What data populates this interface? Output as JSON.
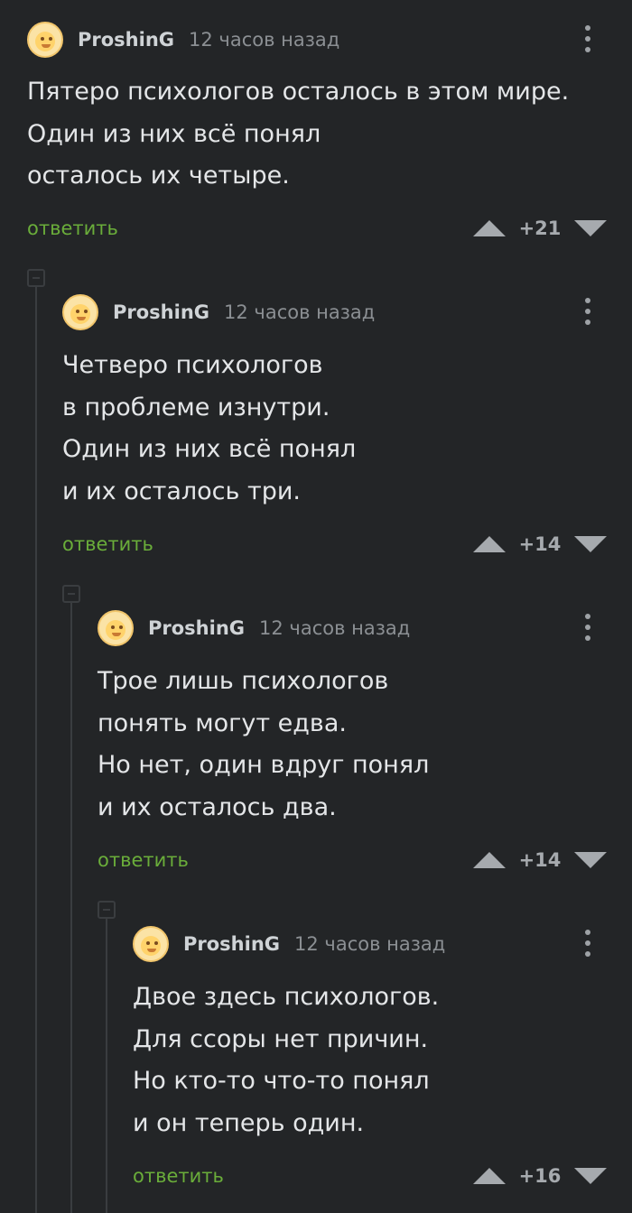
{
  "comments": [
    {
      "author": "ProshinG",
      "time": "12 часов назад",
      "lines": [
        "Пятеро психологов осталось в этом мире.",
        "Один из них всё понял",
        "осталось их четыре."
      ],
      "reply_label": "ответить",
      "rating": "+21"
    },
    {
      "author": "ProshinG",
      "time": "12 часов назад",
      "lines": [
        "Четверо психологов",
        "в проблеме изнутри.",
        "Один из них всё понял",
        "и их осталось три."
      ],
      "reply_label": "ответить",
      "rating": "+14"
    },
    {
      "author": "ProshinG",
      "time": "12 часов назад",
      "lines": [
        "Трое лишь психологов",
        "понять могут едва.",
        "Но нет, один вдруг понял",
        "и их осталось два."
      ],
      "reply_label": "ответить",
      "rating": "+14"
    },
    {
      "author": "ProshinG",
      "time": "12 часов назад",
      "lines": [
        "Двое здесь психологов.",
        "Для ссоры нет причин.",
        "Но кто-то что-то понял",
        "и он теперь один."
      ],
      "reply_label": "ответить",
      "rating": "+16"
    }
  ],
  "icons": {
    "avatar": "avatar-emoji-icon",
    "more": "more-vertical-icon",
    "upvote": "upvote-icon",
    "downvote": "downvote-icon",
    "collapse": "collapse-thread-icon"
  },
  "colors": {
    "background": "#232527",
    "reply": "#6aad3a",
    "text": "#e4e6e8",
    "muted": "#8b8f93"
  }
}
